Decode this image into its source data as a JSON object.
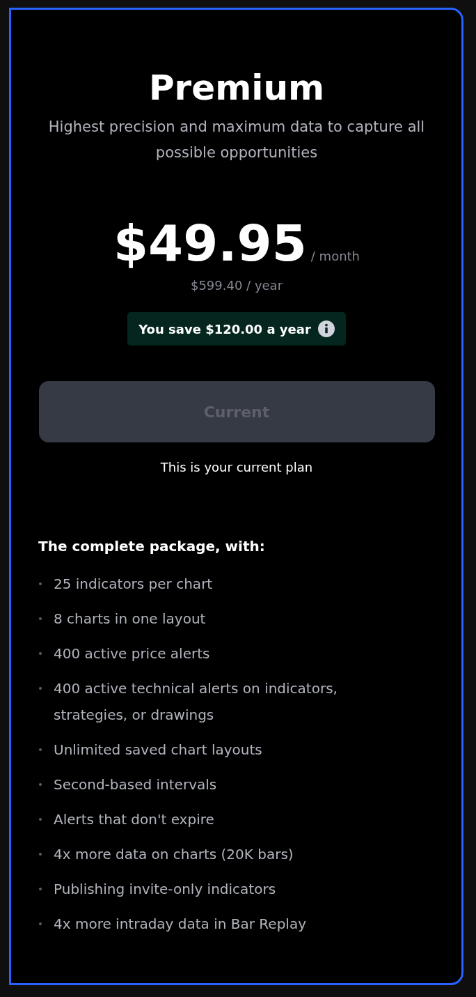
{
  "plan": {
    "title": "Premium",
    "subtitle": "Highest precision and maximum data to capture all possible opportunities",
    "price": "$49.95",
    "period": "/ month",
    "yearly": "$599.40 / year",
    "savings": "You save $120.00 a year",
    "button": {
      "label": "Current",
      "disabled": true
    },
    "note": "This is your current plan"
  },
  "features": {
    "heading": "The complete package, with:",
    "items": [
      "25 indicators per chart",
      "8 charts in one layout",
      "400 active price alerts",
      "400 active technical alerts on indicators, strategies, or drawings",
      "Unlimited saved chart layouts",
      "Second-based intervals",
      "Alerts that don't expire",
      "4x more data on charts (20K bars)",
      "Publishing invite-only indicators",
      "4x more intraday data in Bar Replay"
    ]
  }
}
